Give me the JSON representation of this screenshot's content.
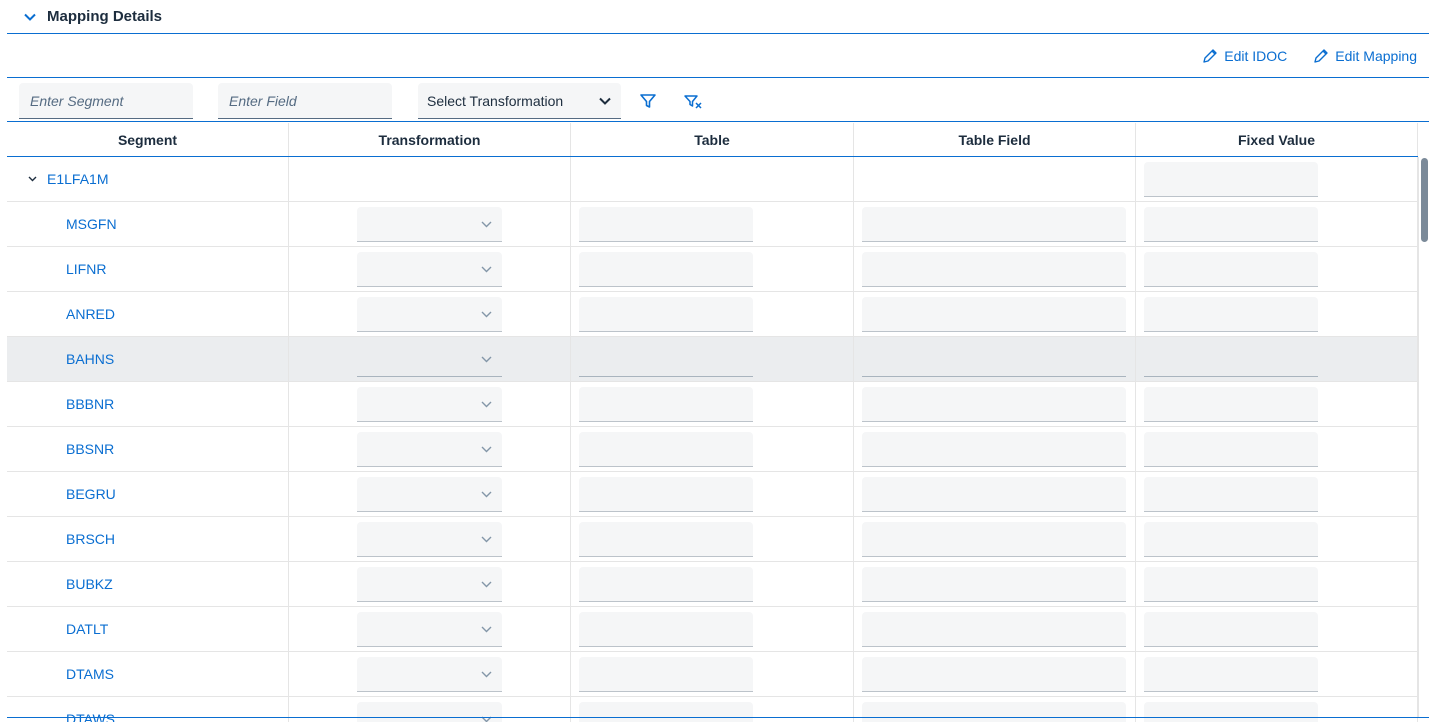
{
  "section": {
    "title": "Mapping Details",
    "expand_icon": "chevron-down-icon"
  },
  "toolbar": {
    "edit_idoc_label": "Edit IDOC",
    "edit_mapping_label": "Edit Mapping",
    "edit_icon": "pencil-icon"
  },
  "filters": {
    "segment_placeholder": "Enter Segment",
    "field_placeholder": "Enter Field",
    "transformation_label": "Select Transformation",
    "filter_icon": "filter-icon",
    "clear_filter_icon": "clear-filter-icon"
  },
  "table": {
    "columns": [
      "Segment",
      "Transformation",
      "Table",
      "Table Field",
      "Fixed Value"
    ],
    "parent_segment": "E1LFA1M",
    "fields": [
      "MSGFN",
      "LIFNR",
      "ANRED",
      "BAHNS",
      "BBBNR",
      "BBSNR",
      "BEGRU",
      "BRSCH",
      "BUBKZ",
      "DATLT",
      "DTAMS",
      "DTAWS"
    ],
    "highlighted_row": "BAHNS"
  },
  "colors": {
    "accent": "#0a6ed1",
    "highlight_row": "#ebedef",
    "text": "#1d2d3e"
  }
}
